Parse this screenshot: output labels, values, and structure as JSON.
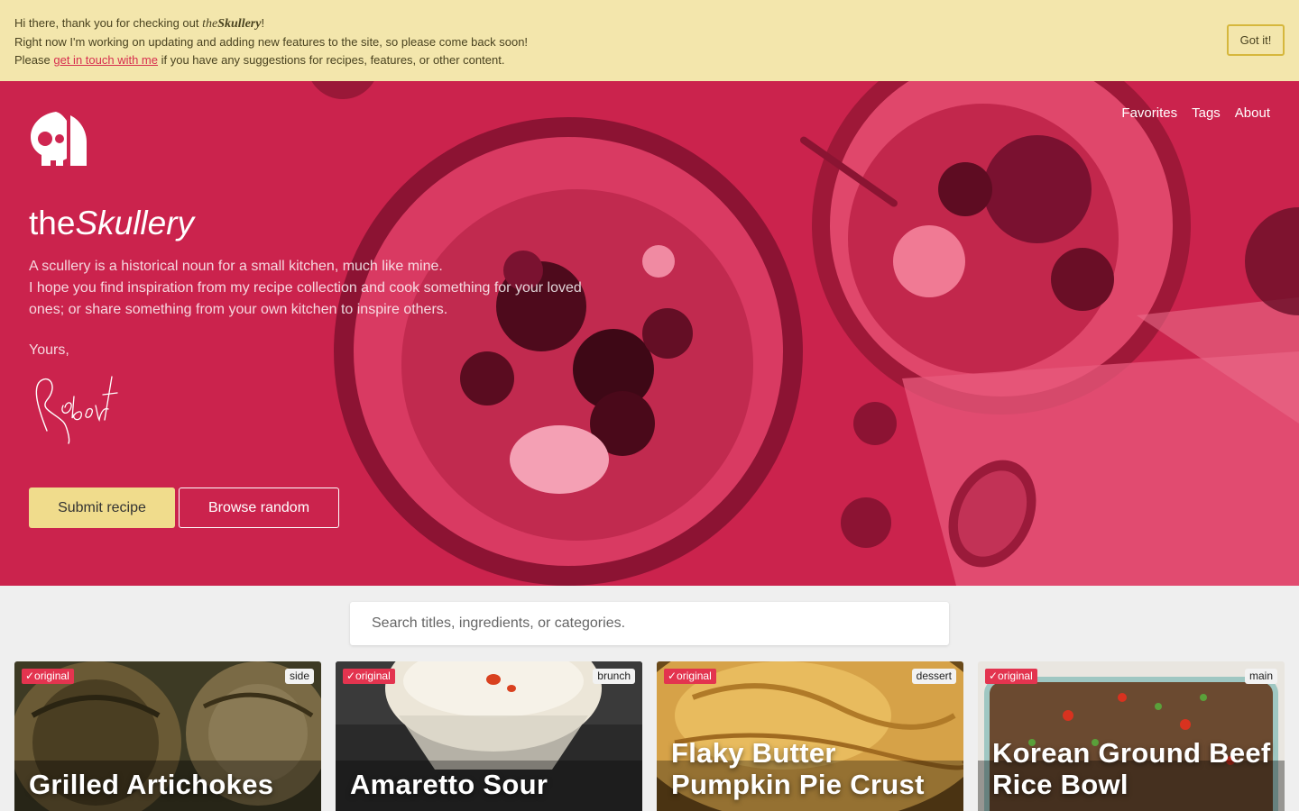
{
  "banner": {
    "line1_prefix": "Hi there, thank you for checking out ",
    "line1_brand_the": "the",
    "line1_brand_name": "Skullery",
    "line1_suffix": "!",
    "line2": "Right now I'm working on updating and adding new features to the site, so please come back soon!",
    "line3_prefix": "Please ",
    "line3_link": "get in touch with me",
    "line3_suffix": " if you have any suggestions for recipes, features, or other content.",
    "dismiss_label": "Got it!"
  },
  "nav": {
    "items": [
      {
        "label": "Favorites"
      },
      {
        "label": "Tags"
      },
      {
        "label": "About"
      }
    ]
  },
  "hero": {
    "brand_the": "the",
    "brand_name": "Skullery",
    "intro_line1": "A scullery is a historical noun for a small kitchen, much like mine.",
    "intro_line2": "I hope you find inspiration from my recipe collection and cook something for your loved ones; or share something from your own kitchen to inspire others.",
    "closing": "Yours,",
    "signature_text": "Robert",
    "submit_label": "Submit recipe",
    "random_label": "Browse random",
    "accent_color": "#cf2550"
  },
  "search": {
    "placeholder": "Search titles, ingredients, or categories."
  },
  "recipes": [
    {
      "title": "Grilled Artichokes",
      "badge": "✓original",
      "category": "side"
    },
    {
      "title": "Amaretto Sour",
      "badge": "✓original",
      "category": "brunch"
    },
    {
      "title": "Flaky Butter Pumpkin Pie Crust",
      "badge": "✓original",
      "category": "dessert"
    },
    {
      "title": "Korean Ground Beef Rice Bowl",
      "badge": "✓original",
      "category": "main"
    }
  ],
  "colors": {
    "banner_bg": "#f3e6ac",
    "link": "#d72f4f",
    "submit_bg": "#f0dc8c",
    "badge_original": "#e3344f"
  }
}
